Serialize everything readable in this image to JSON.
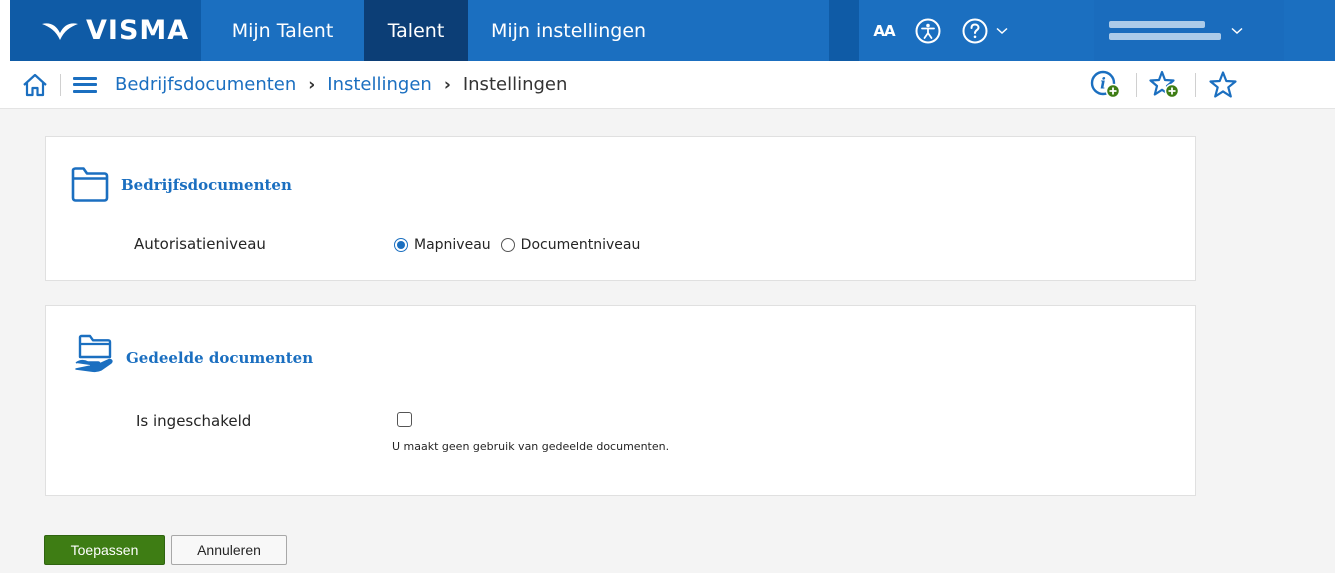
{
  "brand": {
    "logo_text": "VISMA"
  },
  "nav": {
    "items": [
      {
        "label": "Mijn Talent"
      },
      {
        "label": "Talent"
      },
      {
        "label": "Mijn instellingen"
      }
    ],
    "font_size_label": "AA",
    "accessibility_icon": "accessibility-icon",
    "help_icon": "help-icon"
  },
  "breadcrumb": {
    "items": [
      "Bedrijfsdocumenten",
      "Instellingen",
      "Instellingen"
    ],
    "separator": "›"
  },
  "company_documents": {
    "title": "Bedrijfsdocumenten",
    "authorization_label": "Autorisatieniveau",
    "options": [
      {
        "label": "Mapniveau",
        "selected": true
      },
      {
        "label": "Documentniveau",
        "selected": false
      }
    ]
  },
  "shared_documents": {
    "title": "Gedeelde documenten",
    "enabled_label": "Is ingeschakeld",
    "enabled": false,
    "note": "U maakt geen gebruik van gedeelde documenten."
  },
  "actions": {
    "apply_label": "Toepassen",
    "cancel_label": "Annuleren"
  },
  "colors": {
    "brand_blue": "#1b6fc0",
    "nav_active": "#0c3e76",
    "apply_green": "#3e7d14"
  }
}
